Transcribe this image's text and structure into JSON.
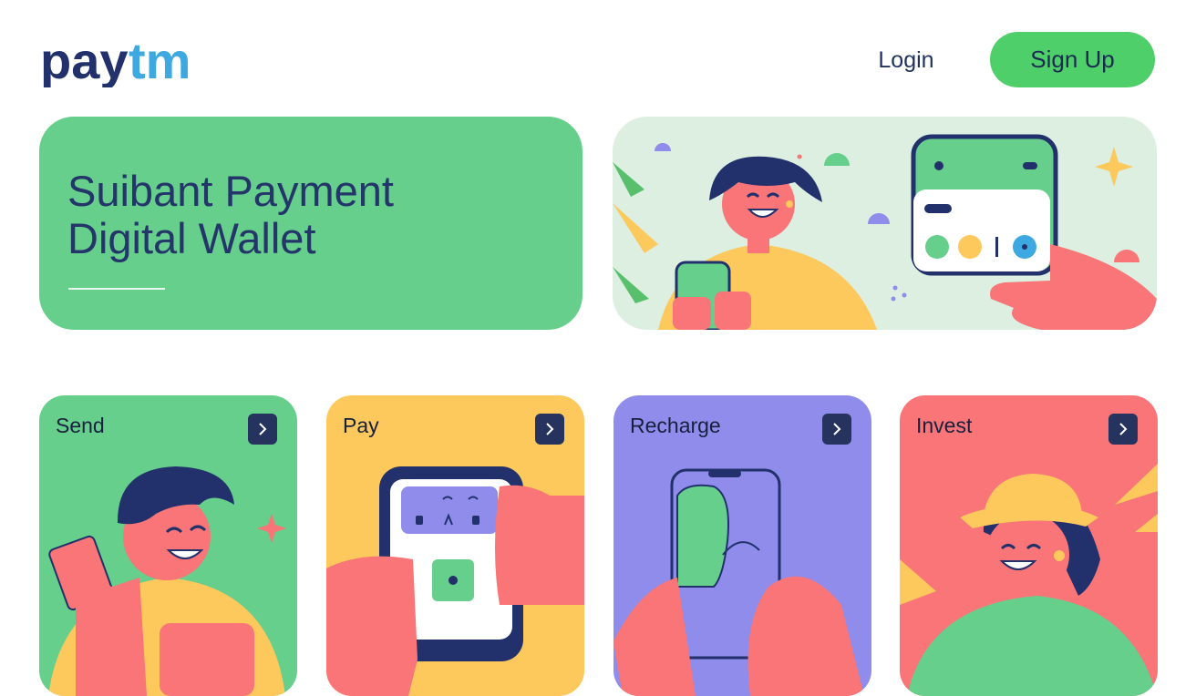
{
  "header": {
    "logo_text": "paytm",
    "login_label": "Login",
    "signup_label": "Sign Up"
  },
  "hero": {
    "title_line1": "Suibant Payment",
    "title_line2": "Digital Wallet"
  },
  "cards": [
    {
      "label": "Send",
      "color": "#66cf8c"
    },
    {
      "label": "Pay",
      "color": "#fdc85c"
    },
    {
      "label": "Recharge",
      "color": "#8f8ceb"
    },
    {
      "label": "Invest",
      "color": "#f97577"
    }
  ],
  "icons": {
    "card_arrow": "chevron-right-icon"
  },
  "colors": {
    "brand_dark": "#22316b",
    "brand_light": "#3ea8e0",
    "accent_green": "#4ecf69"
  }
}
